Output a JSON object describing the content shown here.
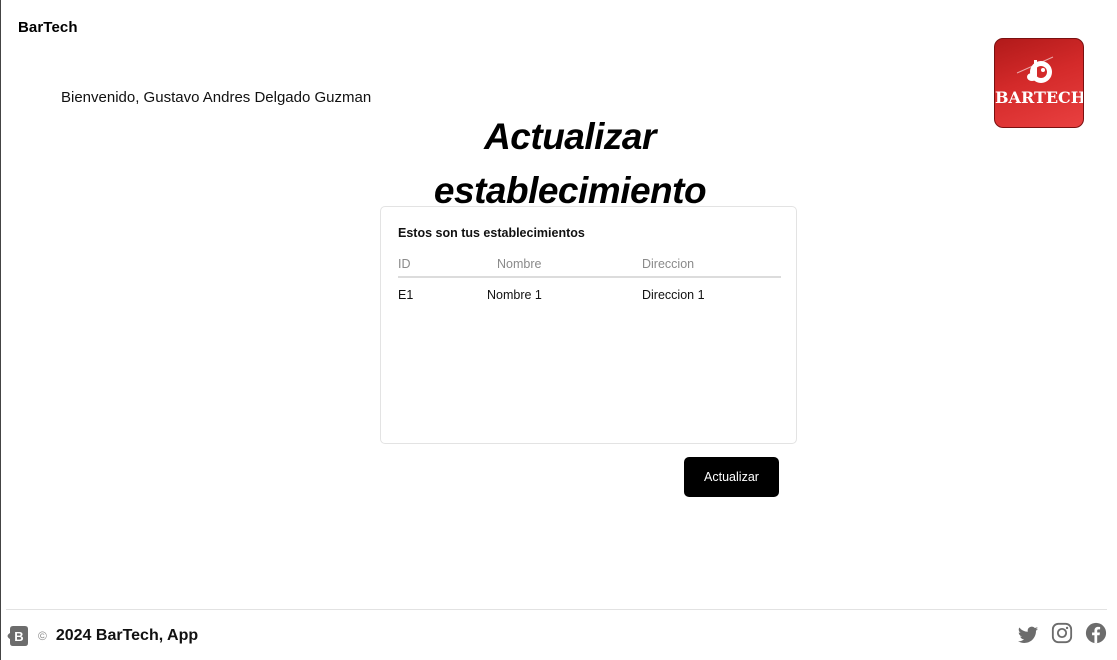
{
  "app": {
    "brand": "BarTech",
    "logo_text": "BARTECH"
  },
  "header": {
    "welcome": "Bienvenido, Gustavo Andres Delgado Guzman"
  },
  "main": {
    "title": "Actualizar establecimiento",
    "card_heading": "Estos son tus establecimientos",
    "columns": [
      "ID",
      "Nombre",
      "Direccion"
    ],
    "rows": [
      {
        "id": "E1",
        "nombre": "Nombre 1",
        "direccion": "Direccion 1"
      }
    ],
    "update_button": "Actualizar"
  },
  "footer": {
    "copyright_symbol": "©",
    "text": "2024 BarTech, App",
    "social_icons": [
      "twitter-icon",
      "instagram-icon",
      "facebook-icon"
    ]
  },
  "colors": {
    "logo_red": "#d42a2a",
    "button_bg": "#000000",
    "text": "#111111",
    "muted": "#8a8a8a"
  }
}
